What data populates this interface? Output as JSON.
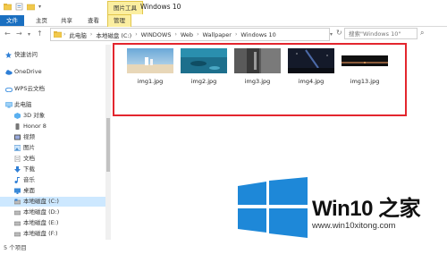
{
  "window": {
    "title": "Windows 10",
    "tool_tab": "图片工具"
  },
  "ribbon_tabs": [
    {
      "label": "文件"
    },
    {
      "label": "主页"
    },
    {
      "label": "共享"
    },
    {
      "label": "查看"
    },
    {
      "label": "管理"
    }
  ],
  "address": {
    "crumbs": [
      "此电脑",
      "本地磁盘 (C:)",
      "WINDOWS",
      "Web",
      "Wallpaper",
      "Windows 10"
    ]
  },
  "search": {
    "placeholder": "搜索\"Windows 10\""
  },
  "sidebar": {
    "items": [
      {
        "label": "快速访问",
        "icon": "star-icon",
        "color": "#2f7fd6"
      },
      {
        "label": "OneDrive",
        "icon": "cloud-icon",
        "color": "#2f7fd6"
      },
      {
        "label": "WPS云文档",
        "icon": "cloud-icon",
        "color": "#3b8ee0"
      },
      {
        "label": "此电脑",
        "icon": "computer-icon",
        "color": "#4aa3e8"
      },
      {
        "label": "3D 对象",
        "icon": "cube-icon",
        "color": "#5ab0f0"
      },
      {
        "label": "Honor 8",
        "icon": "phone-icon",
        "color": "#777777"
      },
      {
        "label": "视频",
        "icon": "video-icon",
        "color": "#555555"
      },
      {
        "label": "图片",
        "icon": "picture-icon",
        "color": "#4a90d0"
      },
      {
        "label": "文档",
        "icon": "document-icon",
        "color": "#7a7a7a"
      },
      {
        "label": "下载",
        "icon": "download-icon",
        "color": "#2f7fd6"
      },
      {
        "label": "音乐",
        "icon": "music-icon",
        "color": "#2f7fd6"
      },
      {
        "label": "桌面",
        "icon": "desktop-icon",
        "color": "#3a8ad8"
      },
      {
        "label": "本地磁盘 (C:)",
        "icon": "drive-icon",
        "color": "#666666"
      },
      {
        "label": "本地磁盘 (D:)",
        "icon": "drive-icon",
        "color": "#666666"
      },
      {
        "label": "本地磁盘 (E:)",
        "icon": "drive-icon",
        "color": "#666666"
      },
      {
        "label": "本地磁盘 (F:)",
        "icon": "drive-icon",
        "color": "#666666"
      }
    ]
  },
  "files": [
    {
      "name": "img1.jpg"
    },
    {
      "name": "img2.jpg"
    },
    {
      "name": "img3.jpg"
    },
    {
      "name": "img4.jpg"
    },
    {
      "name": "img13.jpg"
    }
  ],
  "status": {
    "count_text": "5 个项目"
  },
  "watermark": {
    "brand": "Win10 之家",
    "url": "www.win10xitong.com"
  },
  "colors": {
    "accent": "#1a6fc0",
    "highlight": "#e3262e",
    "tool_tab": "#fbeea0",
    "selected": "#cde8ff"
  }
}
